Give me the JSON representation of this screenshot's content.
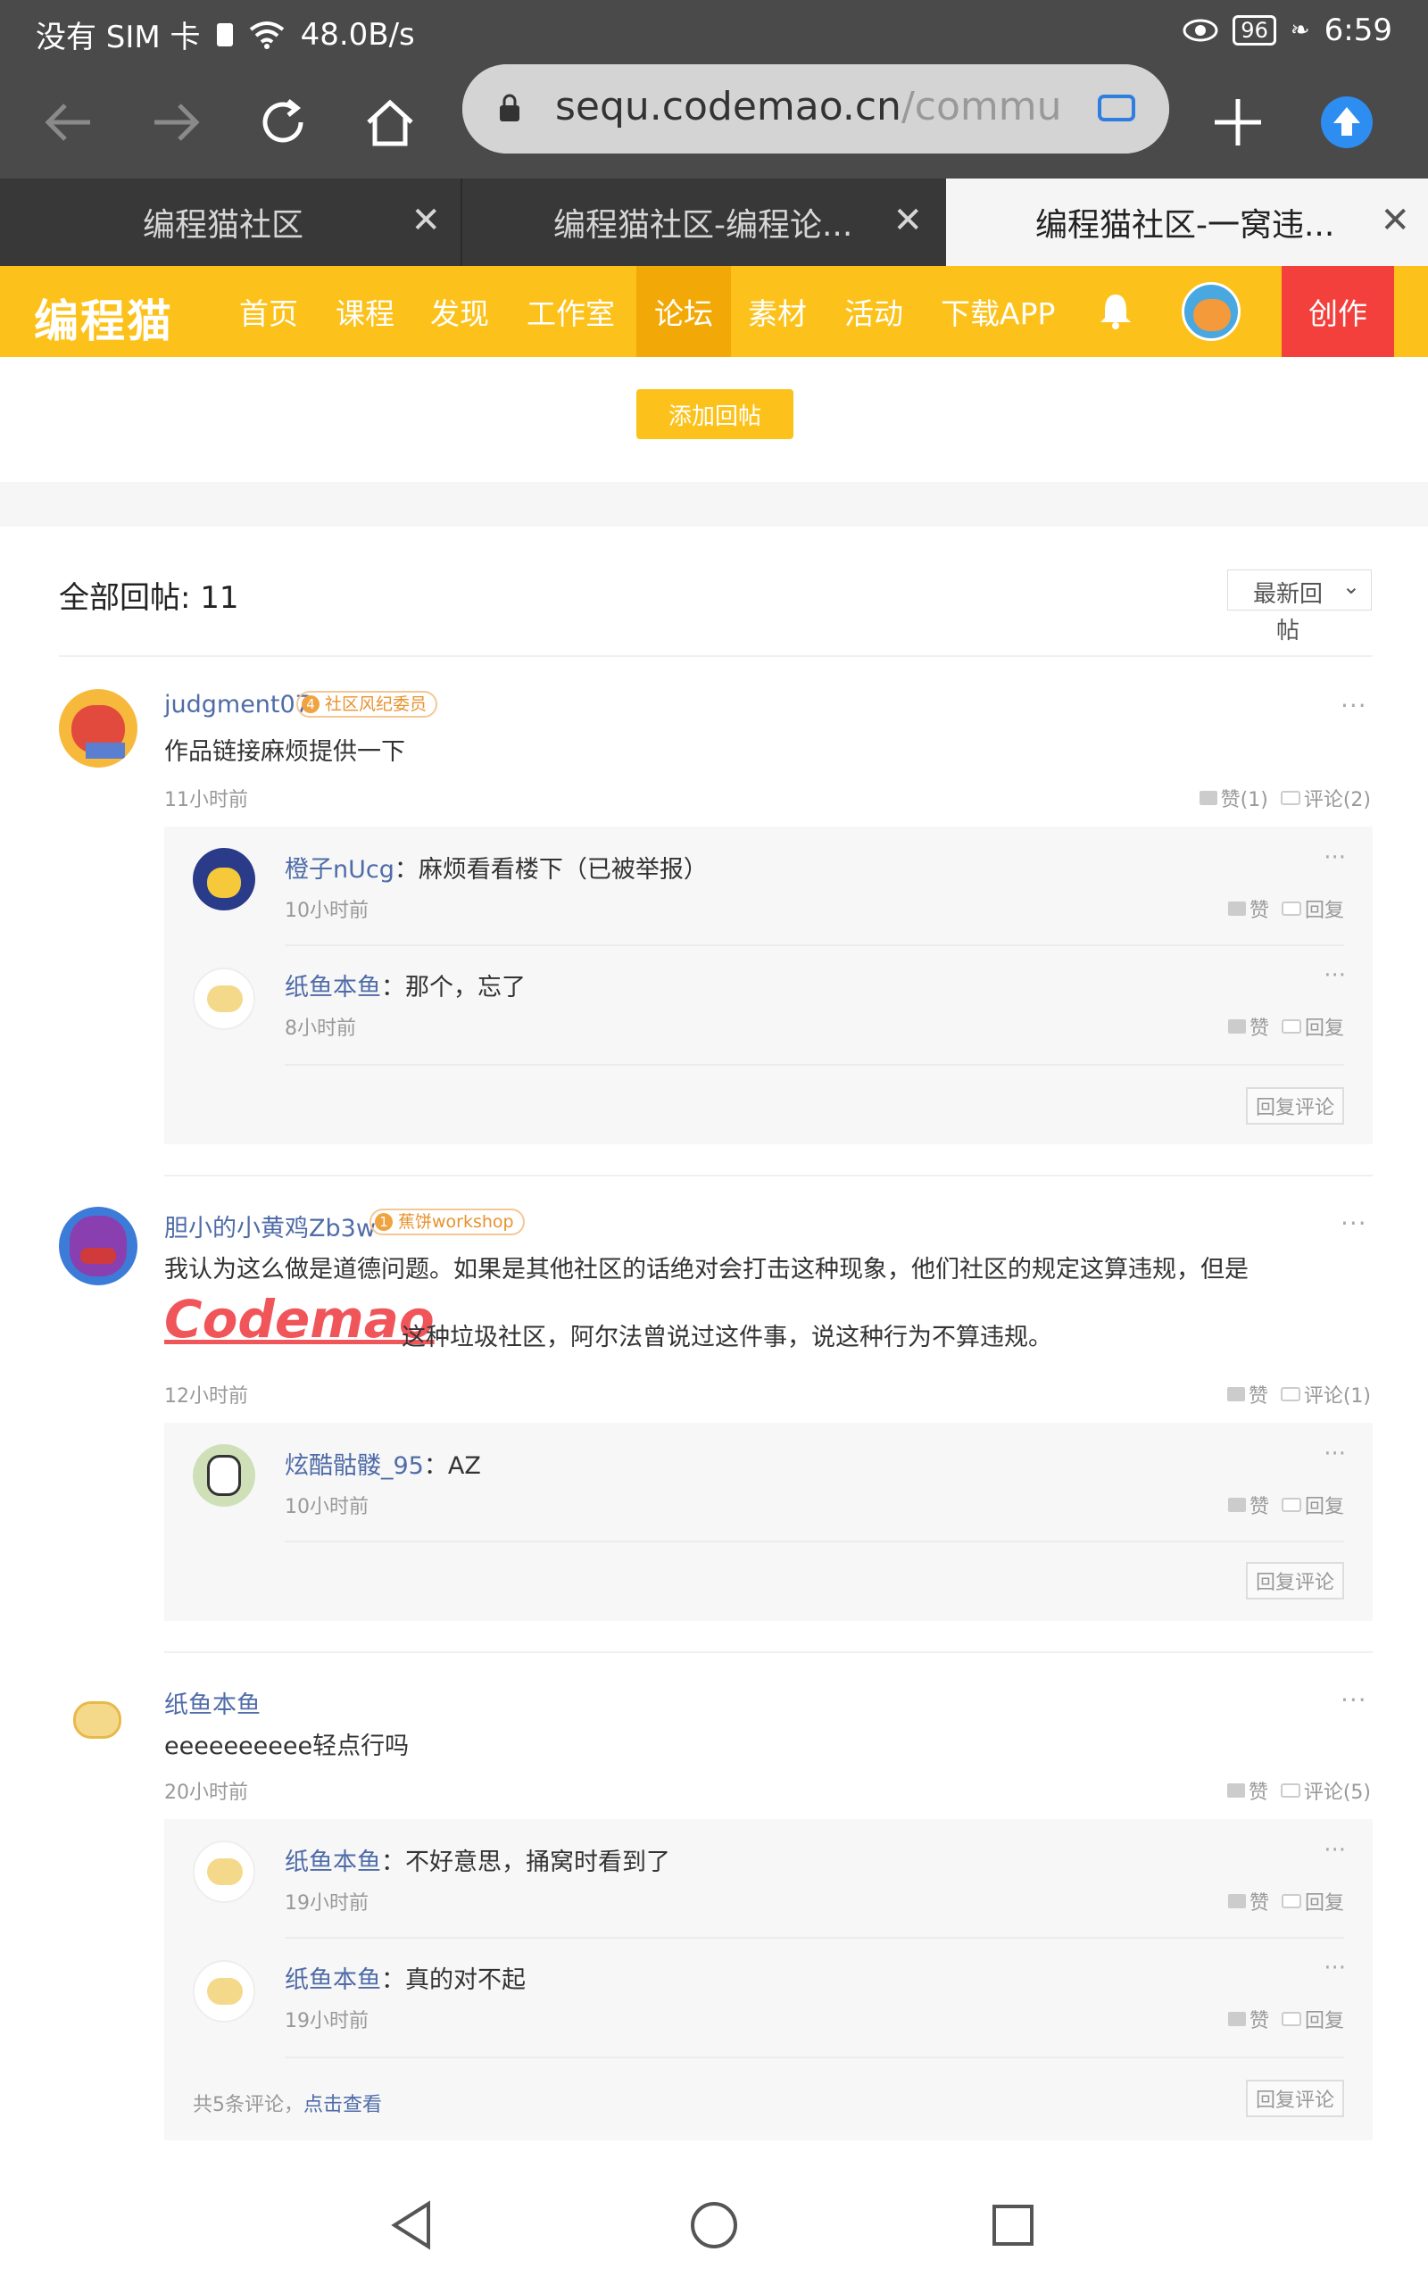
{
  "status_bar": {
    "carrier": "没有 SIM 卡",
    "speed": "48.0B/s",
    "battery": "96",
    "time": "6:59"
  },
  "browser": {
    "url_domain": "sequ.codemao.cn",
    "url_rest": "/commu",
    "tabs": [
      {
        "title": "编程猫社区"
      },
      {
        "title": "编程猫社区-编程论..."
      },
      {
        "title": "编程猫社区-一窝违..."
      }
    ]
  },
  "site_nav": {
    "logo": "编程猫",
    "items": [
      "首页",
      "课程",
      "发现",
      "工作室",
      "论坛",
      "素材",
      "活动",
      "下载APP"
    ],
    "active": "论坛",
    "create": "创作"
  },
  "add_reply_button": "添加回帖",
  "replies_header": {
    "label": "全部回帖: 11",
    "sort_line1": "最新回",
    "sort_line2": "帖"
  },
  "colors": {
    "brand_yellow": "#fcc21b",
    "active_yellow": "#f2a907",
    "create_red": "#f4403c",
    "link_blue": "#4f6ca8"
  },
  "posts": [
    {
      "author": "judgment07",
      "badge_num": "4",
      "badge": "社区风纪委员",
      "text": "作品链接麻烦提供一下",
      "time": "11小时前",
      "like": "赞(1)",
      "comment": "评论(2)",
      "comments": [
        {
          "name": "橙子nUcg",
          "text": "：麻烦看看楼下（已被举报）",
          "time": "10小时前",
          "like": "赞",
          "reply": "回复"
        },
        {
          "name": "纸鱼本鱼",
          "text": "：那个，忘了",
          "time": "8小时前",
          "like": "赞",
          "reply": "回复"
        }
      ],
      "reply_button": "回复评论"
    },
    {
      "author": "胆小的小黄鸡Zb3w",
      "badge_num": "1",
      "badge": "蕉饼workshop",
      "text_line1": "我认为这么做是道德问题。如果是其他社区的话绝对会打击这种现象，他们社区的规定这算违规，但是",
      "codemao": "Codemao",
      "text_line2": "这种垃圾社区，阿尔法曾说过这件事，说这种行为不算违规。",
      "time": "12小时前",
      "like": "赞",
      "comment": "评论(1)",
      "comments": [
        {
          "name": "炫酷骷髅_95",
          "text": "：AZ",
          "time": "10小时前",
          "like": "赞",
          "reply": "回复"
        }
      ],
      "reply_button": "回复评论"
    },
    {
      "author": "纸鱼本鱼",
      "text": "eeeeeeeeee轻点行吗",
      "time": "20小时前",
      "like": "赞",
      "comment": "评论(5)",
      "comments": [
        {
          "name": "纸鱼本鱼",
          "text": "：不好意思，捅窝时看到了",
          "time": "19小时前",
          "like": "赞",
          "reply": "回复"
        },
        {
          "name": "纸鱼本鱼",
          "text": "：真的对不起",
          "time": "19小时前",
          "like": "赞",
          "reply": "回复"
        }
      ],
      "more_text": "共5条评论，",
      "more_link": "点击查看",
      "reply_button": "回复评论"
    }
  ]
}
